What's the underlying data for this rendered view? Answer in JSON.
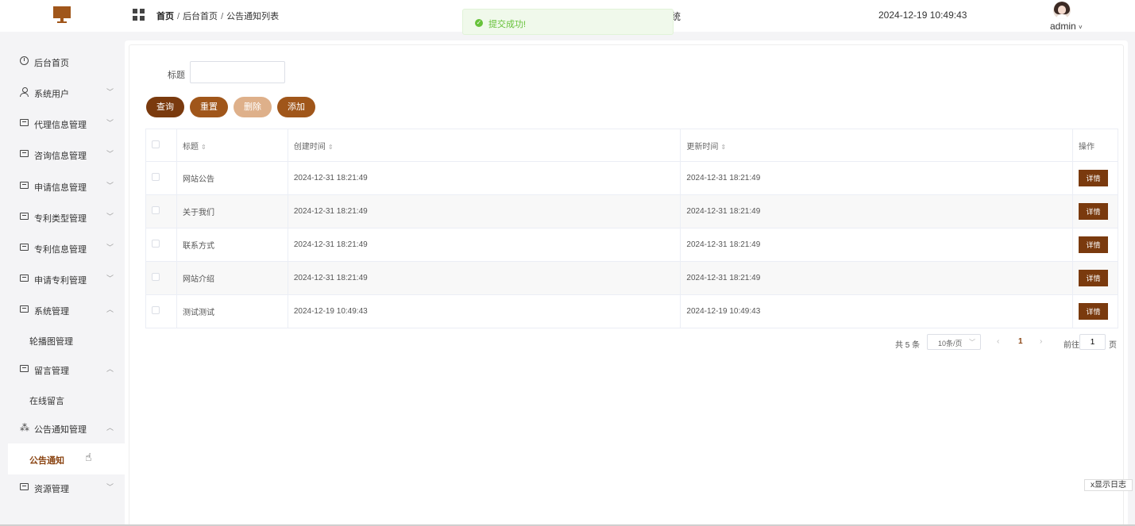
{
  "header": {
    "breadcrumb": [
      "首页",
      "后台首页",
      "公告通知列表"
    ],
    "system_title_fragment": "统",
    "datetime": "2024-12-19 10:49:43",
    "username": "admin"
  },
  "toast": {
    "message": "提交成功!",
    "icon": "success-check-icon"
  },
  "sidebar": {
    "items": [
      {
        "label": "后台首页",
        "icon": "clock-icon"
      },
      {
        "label": "系统用户",
        "icon": "user-icon",
        "arrow": "down"
      },
      {
        "label": "代理信息管理",
        "icon": "box-icon",
        "arrow": "down"
      },
      {
        "label": "咨询信息管理",
        "icon": "box-icon",
        "arrow": "down"
      },
      {
        "label": "申请信息管理",
        "icon": "box-icon",
        "arrow": "down"
      },
      {
        "label": "专利类型管理",
        "icon": "box-icon",
        "arrow": "down"
      },
      {
        "label": "专利信息管理",
        "icon": "box-icon",
        "arrow": "down"
      },
      {
        "label": "申请专利管理",
        "icon": "box-icon",
        "arrow": "down"
      },
      {
        "label": "系统管理",
        "icon": "box-icon",
        "arrow": "up"
      },
      {
        "label": "轮播图管理",
        "sub": true
      },
      {
        "label": "留言管理",
        "icon": "box-icon",
        "arrow": "up"
      },
      {
        "label": "在线留言",
        "sub": true
      },
      {
        "label": "公告通知管理",
        "icon": "spinner-icon",
        "arrow": "up"
      },
      {
        "label": "公告通知",
        "sub": true,
        "active": true
      },
      {
        "label": "资源管理",
        "icon": "printer-icon",
        "arrow": "down"
      }
    ]
  },
  "filter": {
    "title_label": "标题",
    "title_value": ""
  },
  "buttons": {
    "query": "查询",
    "reset": "重置",
    "delete": "删除",
    "add": "添加"
  },
  "table": {
    "headers": {
      "title": "标题",
      "created": "创建时间",
      "updated": "更新时间",
      "actions": "操作"
    },
    "rows": [
      {
        "title": "网站公告",
        "created": "2024-12-31 18:21:49",
        "updated": "2024-12-31 18:21:49",
        "action": "详情"
      },
      {
        "title": "关于我们",
        "created": "2024-12-31 18:21:49",
        "updated": "2024-12-31 18:21:49",
        "action": "详情"
      },
      {
        "title": "联系方式",
        "created": "2024-12-31 18:21:49",
        "updated": "2024-12-31 18:21:49",
        "action": "详情"
      },
      {
        "title": "网站介绍",
        "created": "2024-12-31 18:21:49",
        "updated": "2024-12-31 18:21:49",
        "action": "详情"
      },
      {
        "title": "测试测试",
        "created": "2024-12-19 10:49:43",
        "updated": "2024-12-19 10:49:43",
        "action": "详情"
      }
    ]
  },
  "pagination": {
    "total": "共 5 条",
    "page_size": "10条/页",
    "current_page": "1",
    "goto_label": "前往",
    "goto_value": "1",
    "page_unit": "页"
  },
  "log_button": "x显示日志",
  "colors": {
    "brand": "#a0561a",
    "brand_dark": "#7a3a0e",
    "success": "#67c23a"
  }
}
